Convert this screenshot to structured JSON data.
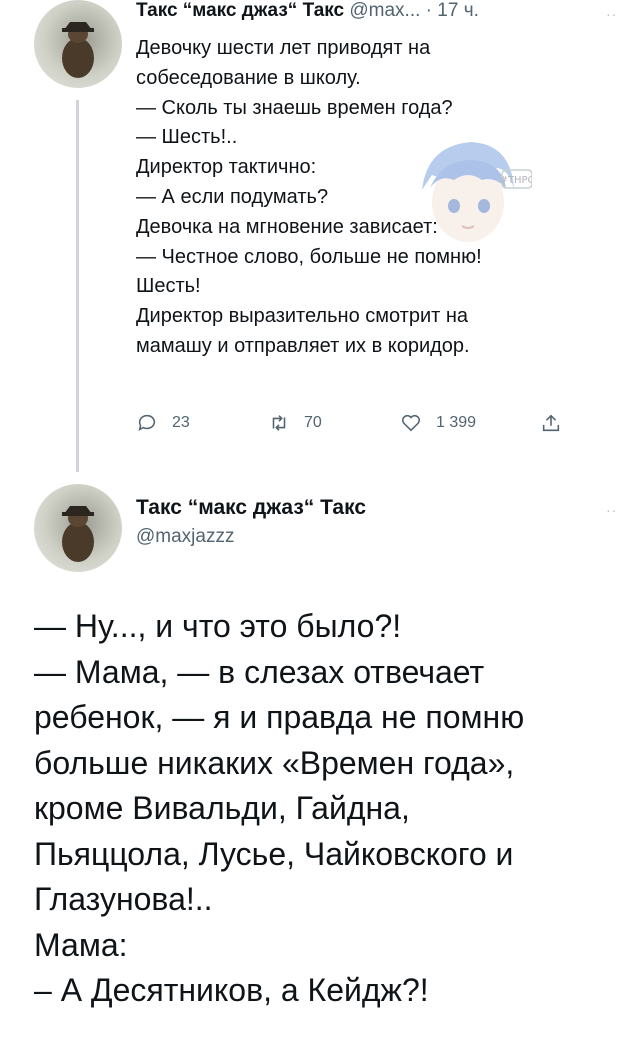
{
  "tweet1": {
    "author_name": "Такс “макс джаз“ Такс",
    "meta": "@max... · 17 ч.",
    "more_icon": "more-dots-icon",
    "lines": [
      "Девочку шести лет приводят на",
      "собеседование в школу.",
      "— Сколь ты знаешь времен года?",
      "— Шесть!..",
      "Директор тактично:",
      "— А если подумать?",
      "Девочка на мгновение зависает:",
      "— Честное слово, больше не помню!",
      "Шесть!",
      "Директор выразительно смотрит на",
      "мамашу и отправляет их в коридор."
    ],
    "actions": {
      "reply_count": "23",
      "retweet_count": "70",
      "like_count": "1 399",
      "reply_icon": "reply-icon",
      "retweet_icon": "retweet-icon",
      "like_icon": "heart-icon",
      "share_icon": "share-icon"
    }
  },
  "tweet2": {
    "author_name": "Такс “макс джаз“ Такс",
    "handle": "@maxjazzz",
    "more_icon": "more-dots-icon",
    "lines": [
      "— Ну..., и что это было?!",
      "— Мама, — в слезах отвечает",
      "ребенок, — я и правда не помню",
      "больше никаких «Времен года»,",
      "кроме Вивальди, Гайдна,",
      "Пьяццола, Лусье, Чайковского и",
      "Глазунова!..",
      "Мама:",
      "– А Десятников, а Кейдж?!"
    ]
  },
  "watermark": {
    "label": "#THPC",
    "icon": "anime-character-watermark"
  },
  "colors": {
    "text": "#0f1419",
    "secondary": "#536471",
    "thread_line": "#d0d4d8"
  }
}
